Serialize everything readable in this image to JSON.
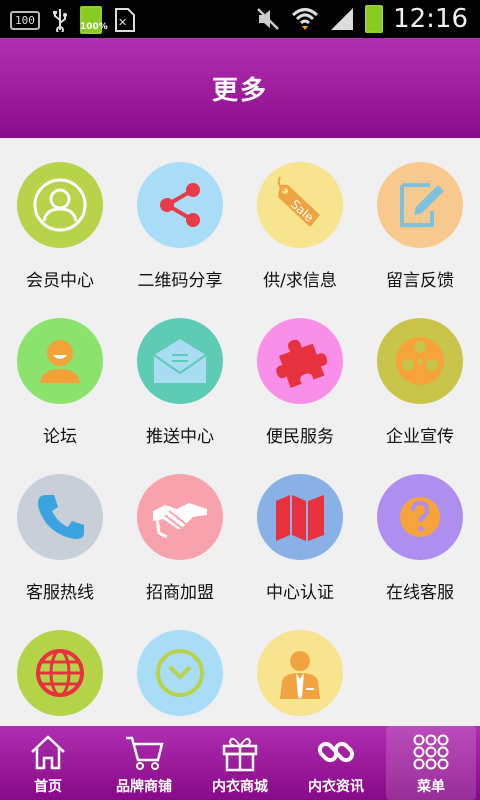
{
  "status_bar": {
    "battery_box_label": "100",
    "battery_percent": "100%",
    "time": "12:16"
  },
  "header": {
    "title": "更多"
  },
  "grid": [
    {
      "label": "会员中心",
      "icon": "user-silhouette-icon",
      "color": "#b7d24b"
    },
    {
      "label": "二维码分享",
      "icon": "share-icon",
      "color": "#a9dcf6"
    },
    {
      "label": "供/求信息",
      "icon": "sale-tag-icon",
      "color": "#f8e38f"
    },
    {
      "label": "留言反馈",
      "icon": "pencil-icon",
      "color": "#f8c98e"
    },
    {
      "label": "论坛",
      "icon": "smiley-user-icon",
      "color": "#8be36e"
    },
    {
      "label": "推送中心",
      "icon": "envelope-icon",
      "color": "#5ecbb4"
    },
    {
      "label": "便民服务",
      "icon": "puzzle-icon",
      "color": "#f98fe9"
    },
    {
      "label": "企业宣传",
      "icon": "film-reel-icon",
      "color": "#c9c54b"
    },
    {
      "label": "客服热线",
      "icon": "phone-icon",
      "color": "#c8cfd8"
    },
    {
      "label": "招商加盟",
      "icon": "handshake-icon",
      "color": "#f7a2ac"
    },
    {
      "label": "中心认证",
      "icon": "map-icon",
      "color": "#8ab1e6"
    },
    {
      "label": "在线客服",
      "icon": "question-icon",
      "color": "#ae8ff0"
    },
    {
      "label": "",
      "icon": "globe-icon",
      "color": "#b5d349"
    },
    {
      "label": "",
      "icon": "clock-icon",
      "color": "#a9dcf6"
    },
    {
      "label": "",
      "icon": "businessman-icon",
      "color": "#f8e38f"
    }
  ],
  "tabbar": [
    {
      "label": "首页",
      "icon": "home-icon"
    },
    {
      "label": "品牌商铺",
      "icon": "cart-icon"
    },
    {
      "label": "内衣商城",
      "icon": "gift-icon"
    },
    {
      "label": "内衣资讯",
      "icon": "link-icon"
    },
    {
      "label": "菜单",
      "icon": "menu-grid-icon"
    }
  ]
}
